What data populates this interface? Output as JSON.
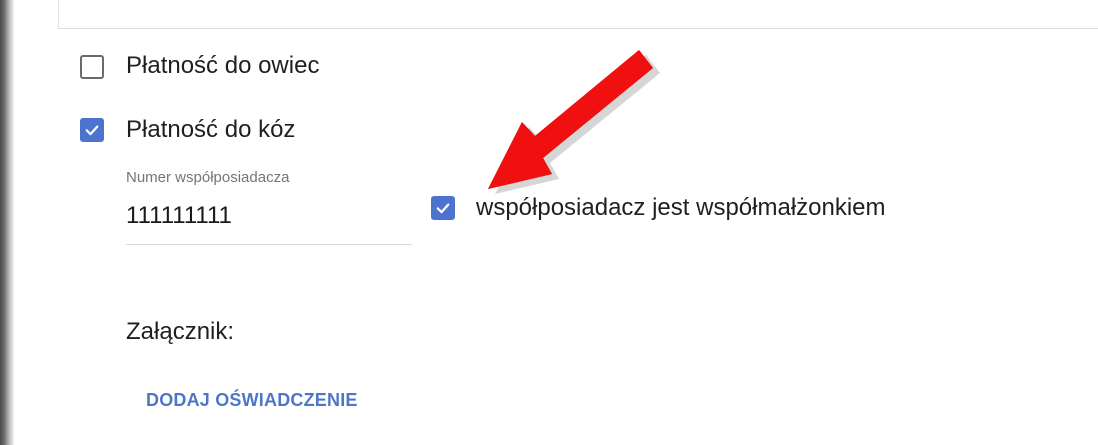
{
  "options": {
    "sheep_payment": {
      "label": "Płatność do owiec",
      "checked": false
    },
    "goat_payment": {
      "label": "Płatność do kóz",
      "checked": true
    },
    "co_owner_spouse": {
      "label": "współposiadacz jest współmałżonkiem",
      "checked": true
    }
  },
  "co_owner_number": {
    "label": "Numer współposiadacza",
    "value": "111111111"
  },
  "attachment": {
    "label": "Załącznik:",
    "button_label": "DODAJ OŚWIADCZENIE"
  },
  "colors": {
    "accent": "#4d73d0",
    "annotation_arrow": "#f01010",
    "button_text": "#4f76c6"
  },
  "icons": {
    "checkbox_checked": "check-icon",
    "annotation": "arrow-icon"
  }
}
